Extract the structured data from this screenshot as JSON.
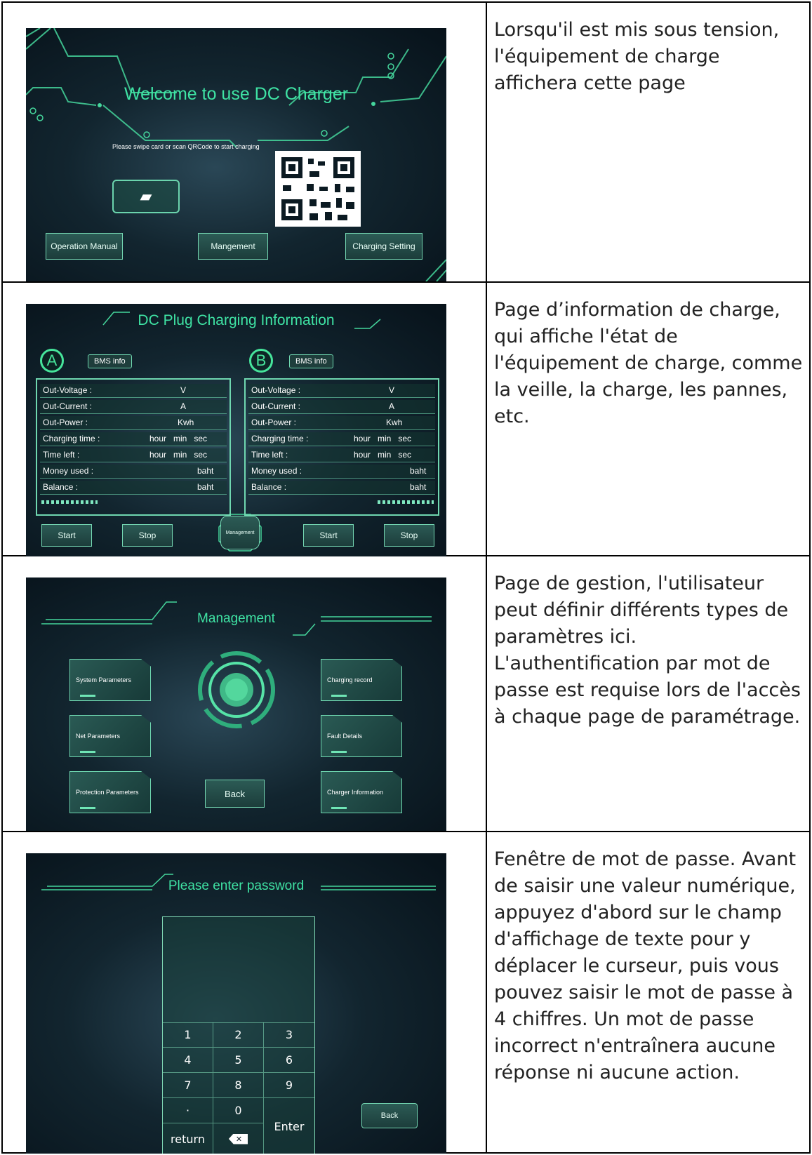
{
  "rows": [
    {
      "screen": {
        "title": "Welcome to use DC Charger",
        "subtitle": "Please swipe card or scan QRCode to start charging",
        "buttons": [
          "Operation  Manual",
          "Mangement",
          "Charging Setting"
        ]
      },
      "description": "Lorsqu'il est mis sous tension, l'équipement de charge affichera cette page"
    },
    {
      "screen": {
        "title": "DC Plug Charging Information",
        "gun_a": "A",
        "gun_b": "B",
        "bms_label": "BMS info",
        "fields": [
          {
            "label": "Out-Voltage :",
            "unit": "V"
          },
          {
            "label": "Out-Current :",
            "unit": "A"
          },
          {
            "label": "Out-Power :",
            "unit": "Kwh"
          },
          {
            "label": "Charging time :",
            "unit": "hour   min   sec"
          },
          {
            "label": "Time left :",
            "unit": "hour   min   sec"
          },
          {
            "label": "Money used :",
            "unit": "baht"
          },
          {
            "label": "Balance :",
            "unit": "baht"
          }
        ],
        "start": "Start",
        "stop": "Stop",
        "management": "Management"
      },
      "description": "Page d’information de charge, qui affiche l'état de l'équipement de charge, comme la veille, la charge, les pannes, etc."
    },
    {
      "screen": {
        "title": "Management",
        "left_cards": [
          "System Parameters",
          "Net Parameters",
          "Protection Parameters"
        ],
        "right_cards": [
          "Charging record",
          "Fault Details",
          "Charger Information"
        ],
        "back": "Back"
      },
      "description": "Page de gestion, l'utilisateur peut définir différents types de paramètres ici.\nL'authentification par mot de passe est requise lors de l'accès à chaque page de paramétrage."
    },
    {
      "screen": {
        "title": "Please enter password",
        "keys": [
          "1",
          "2",
          "3",
          "4",
          "5",
          "6",
          "7",
          "8",
          "9",
          "·",
          "0",
          "Enter",
          "return",
          "✕"
        ],
        "back": "Back"
      },
      "description": "Fenêtre de mot de passe. Avant de saisir une valeur numérique, appuyez d'abord sur le champ d'affichage de texte pour y déplacer le curseur, puis vous pouvez saisir le mot de passe à 4 chiffres. Un mot de passe incorrect n'entraînera aucune réponse ni aucune action."
    }
  ],
  "colors": {
    "accent_green": "#3fe3a4",
    "frame_green": "#6fd7b0",
    "screen_dark": "#0b1a22"
  }
}
